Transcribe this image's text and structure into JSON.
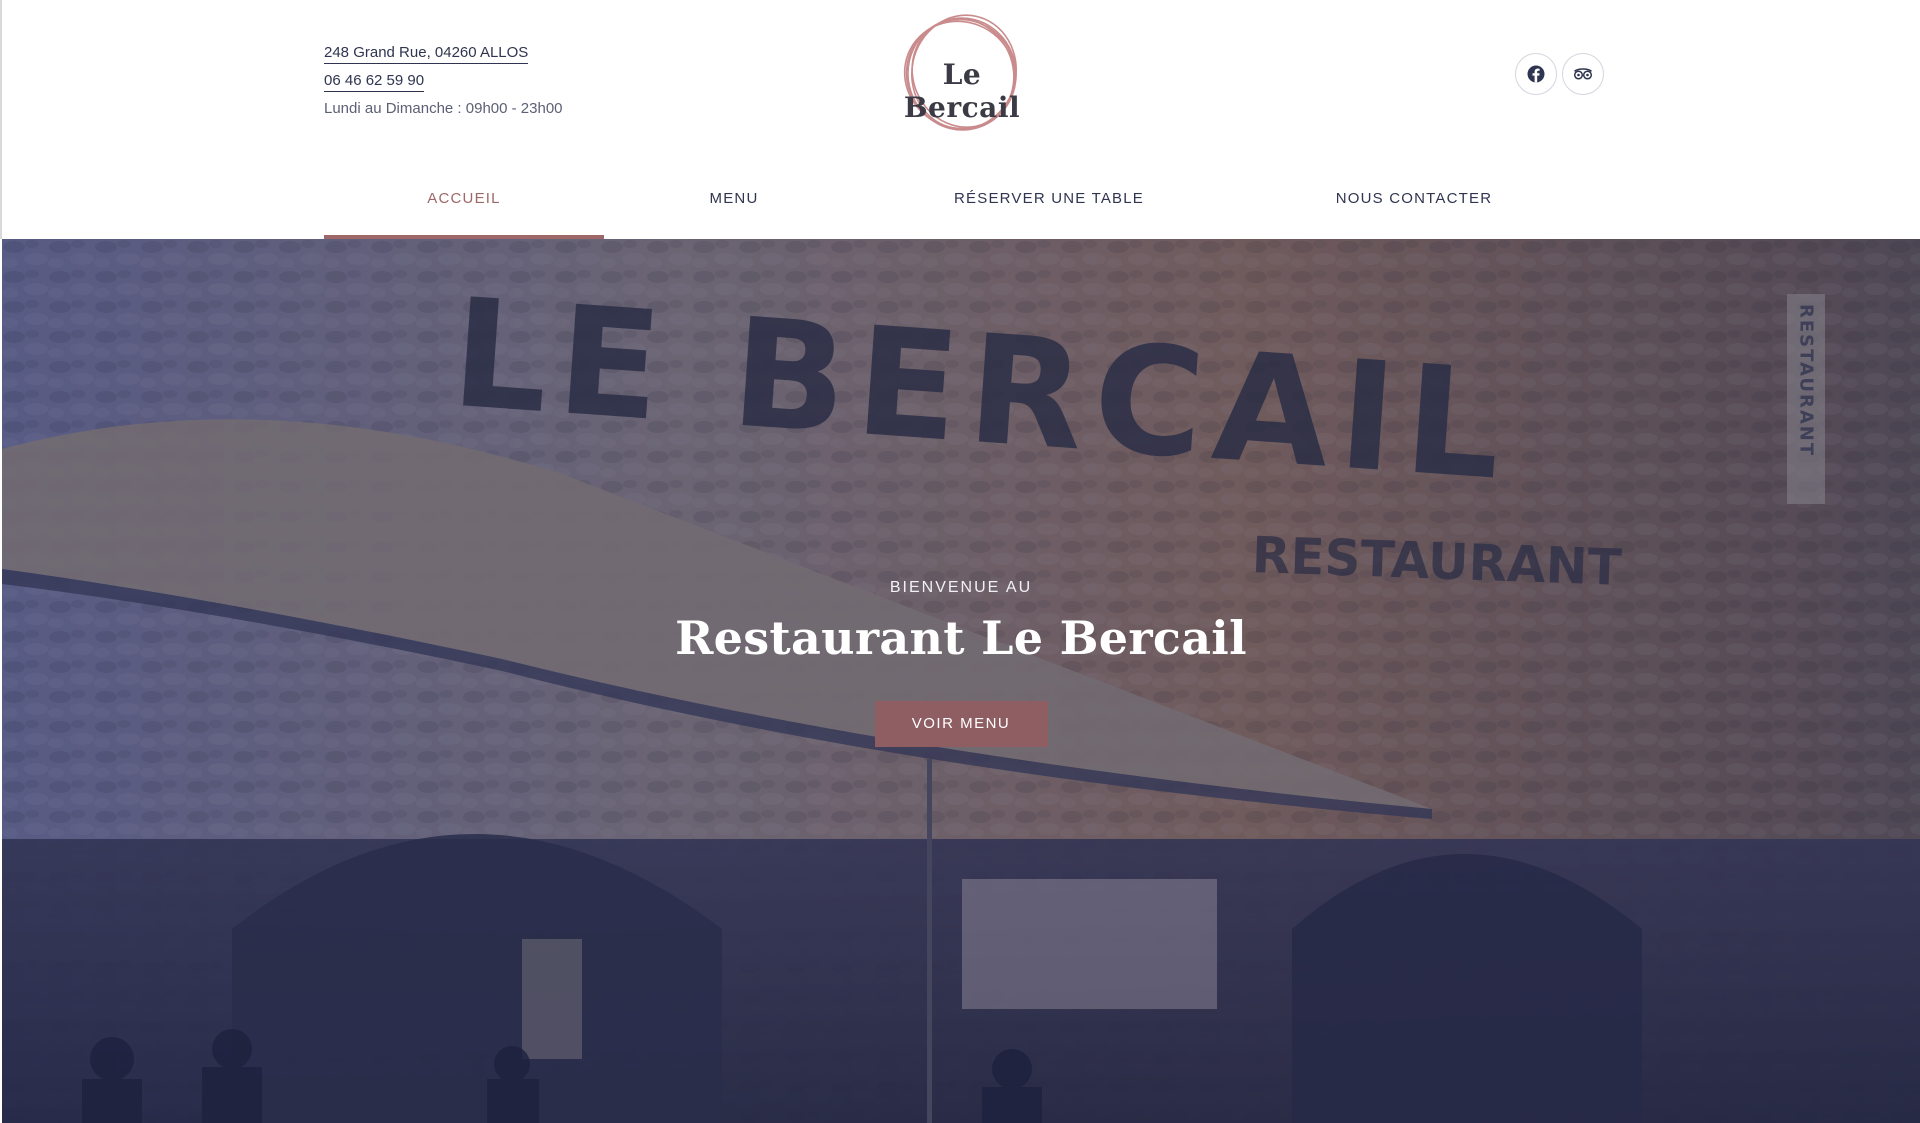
{
  "header": {
    "address": "248 Grand Rue, 04260 ALLOS",
    "phone": "06 46 62 59 90",
    "hours": "Lundi au Dimanche : 09h00 - 23h00",
    "logo_text": "Le Bercail",
    "social": [
      {
        "name": "facebook",
        "icon": "facebook-icon"
      },
      {
        "name": "tripadvisor",
        "icon": "tripadvisor-icon"
      }
    ]
  },
  "nav": {
    "items": [
      {
        "label": "ACCUEIL",
        "active": true
      },
      {
        "label": "MENU",
        "active": false
      },
      {
        "label": "RÉSERVER UNE TABLE",
        "active": false
      },
      {
        "label": "NOUS CONTACTER",
        "active": false
      }
    ]
  },
  "hero": {
    "kicker": "BIENVENUE AU",
    "title": "Restaurant Le Bercail",
    "button_label": "VOIR MENU",
    "sign_text": "LE BERCAIL",
    "sign_subtext": "RESTAURANT",
    "vertical_sign": "RESTAURANT"
  },
  "colors": {
    "accent": "#9e6768",
    "button": "#8e5e62",
    "text": "#2f3550",
    "overlay": "#28305a"
  }
}
